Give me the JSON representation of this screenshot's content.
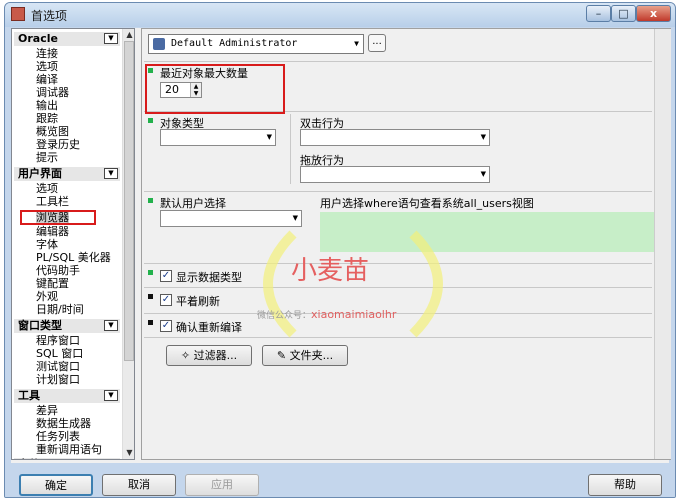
{
  "window": {
    "title": "首选项",
    "min_glyph": "–",
    "max_glyph": "□",
    "close_glyph": "x"
  },
  "left": {
    "groups": [
      {
        "head": "Oracle",
        "items": [
          "连接",
          "选项",
          "编译",
          "调试器",
          "输出",
          "跟踪",
          "概览图",
          "登录历史",
          "提示"
        ]
      },
      {
        "head": "用户界面",
        "items": [
          "选项",
          "工具栏",
          "浏览器",
          "编辑器",
          "字体",
          "PL/SQL 美化器",
          "代码助手",
          "键配置",
          "外观",
          "日期/时间"
        ]
      },
      {
        "head": "窗口类型",
        "items": [
          "程序窗口",
          "SQL 窗口",
          "测试窗口",
          "计划窗口"
        ]
      },
      {
        "head": "工具",
        "items": [
          "差异",
          "数据生成器",
          "任务列表",
          "重新调用语句"
        ]
      },
      {
        "head": "文件",
        "items": []
      }
    ],
    "selected": "浏览器"
  },
  "right": {
    "user": "Default Administrator",
    "dots": "...",
    "max_recent_label": "最近对象最大数量",
    "max_recent_value": "20",
    "object_type_label": "对象类型",
    "double_click_label": "双击行为",
    "drag_drop_label": "拖放行为",
    "default_user_label": "默认用户选择",
    "user_select_where_label": "用户选择where语句查看系统all_users视图",
    "show_data_types_label": "显示数据类型",
    "flat_refresh_label": "平着刷新",
    "confirm_recompile_label": "确认重新编译",
    "filter_button": "过滤器...",
    "folder_button": "文件夹..."
  },
  "footer": {
    "ok": "确定",
    "cancel": "取消",
    "apply": "应用",
    "help": "帮助"
  },
  "watermark": {
    "big": "小麦苗",
    "small_prefix": "微信公众号：",
    "small_id": "xiaomaimiaolhr"
  },
  "colors": {
    "selection_box": "#d81b1b",
    "green_area": "#c7eec8",
    "green_bullet": "#22b14c"
  }
}
